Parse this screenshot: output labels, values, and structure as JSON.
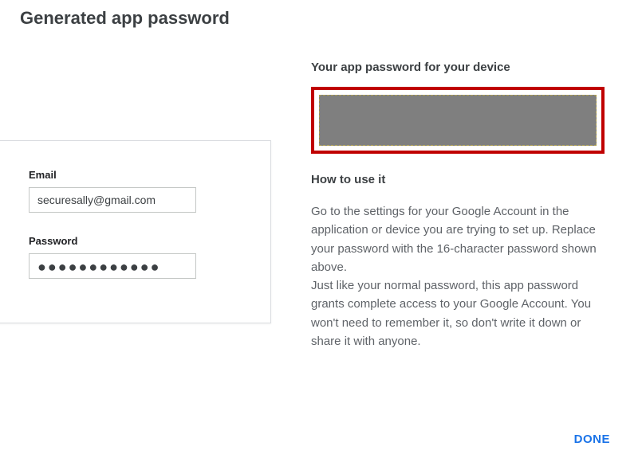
{
  "title": "Generated app password",
  "right": {
    "password_heading": "Your app password for your device",
    "howto_heading": "How to use it",
    "instructions_p1": "Go to the settings for your Google Account in the application or device you are trying to set up. Replace your password with the 16-character password shown above.",
    "instructions_p2": "Just like your normal password, this app password grants complete access to your Google Account. You won't need to remember it, so don't write it down or share it with anyone."
  },
  "login": {
    "email_label": "Email",
    "email_value": "securesally@gmail.com",
    "password_label": "Password",
    "password_value": "●●●●●●●●●●●●"
  },
  "done_label": "DONE"
}
